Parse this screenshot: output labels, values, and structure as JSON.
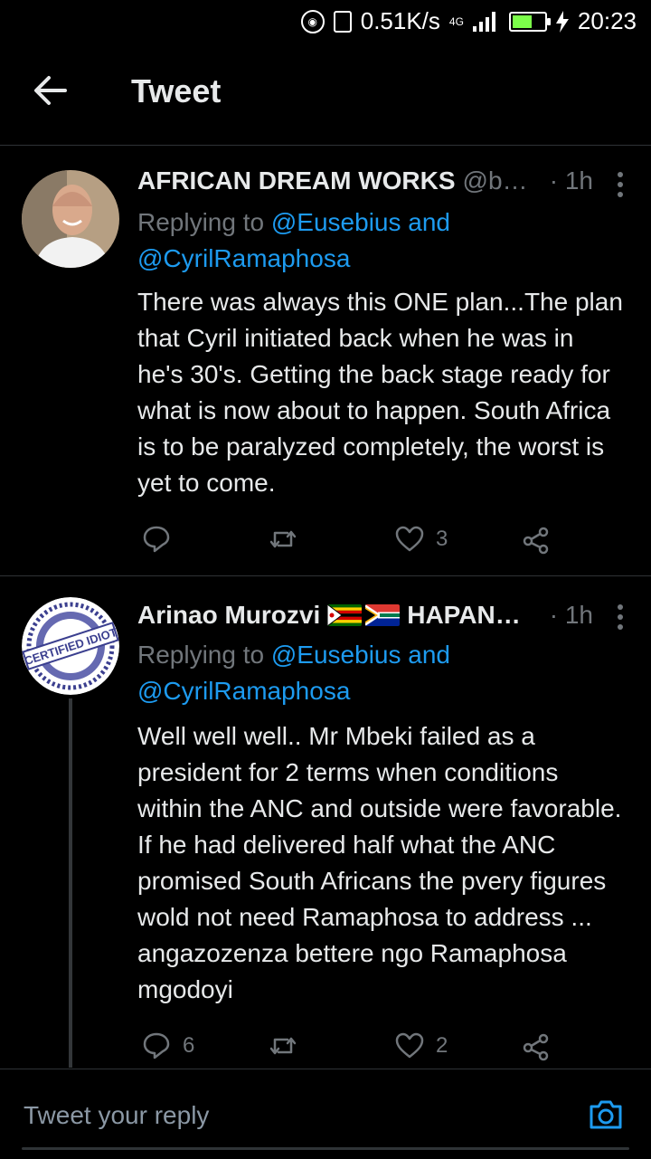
{
  "status_bar": {
    "net_speed": "0.51K/s",
    "network_type": "4G",
    "time": "20:23",
    "battery_color": "#7cff4a"
  },
  "header": {
    "title": "Tweet"
  },
  "tweets": [
    {
      "name": "AFRICAN DREAM WORKS",
      "handle": "@b…",
      "time": "· 1h",
      "reply_prefix": "Replying to ",
      "reply_mentions": "@Eusebius and @CyrilRamaphosa",
      "text": "There was always this ONE plan...The plan that Cyril initiated back when he was in he's 30's. Getting the back stage ready for what is now about to happen. South Africa is to be paralyzed completely, the worst is yet to come.",
      "reply_count": "",
      "retweet_count": "",
      "like_count": "3"
    },
    {
      "name": "Arinao Murozvi",
      "name_suffix": "HAPAN…",
      "time": "· 1h",
      "avatar_text": "CERTIFIED IDIOT",
      "reply_prefix": "Replying to ",
      "reply_mentions": "@Eusebius and @CyrilRamaphosa",
      "text": "Well well well.. Mr Mbeki failed as a president for 2 terms when conditions within the ANC and outside were favorable.  If he had delivered half what the ANC promised South Africans the pvery figures wold not need Ramaphosa to address ... angazozenza bettere ngo Ramaphosa mgodoyi",
      "reply_count": "6",
      "retweet_count": "",
      "like_count": "2"
    }
  ],
  "composer": {
    "placeholder": "Tweet your reply"
  },
  "colors": {
    "accent": "#1d9bf0",
    "muted": "#71767b",
    "background": "#000000"
  }
}
